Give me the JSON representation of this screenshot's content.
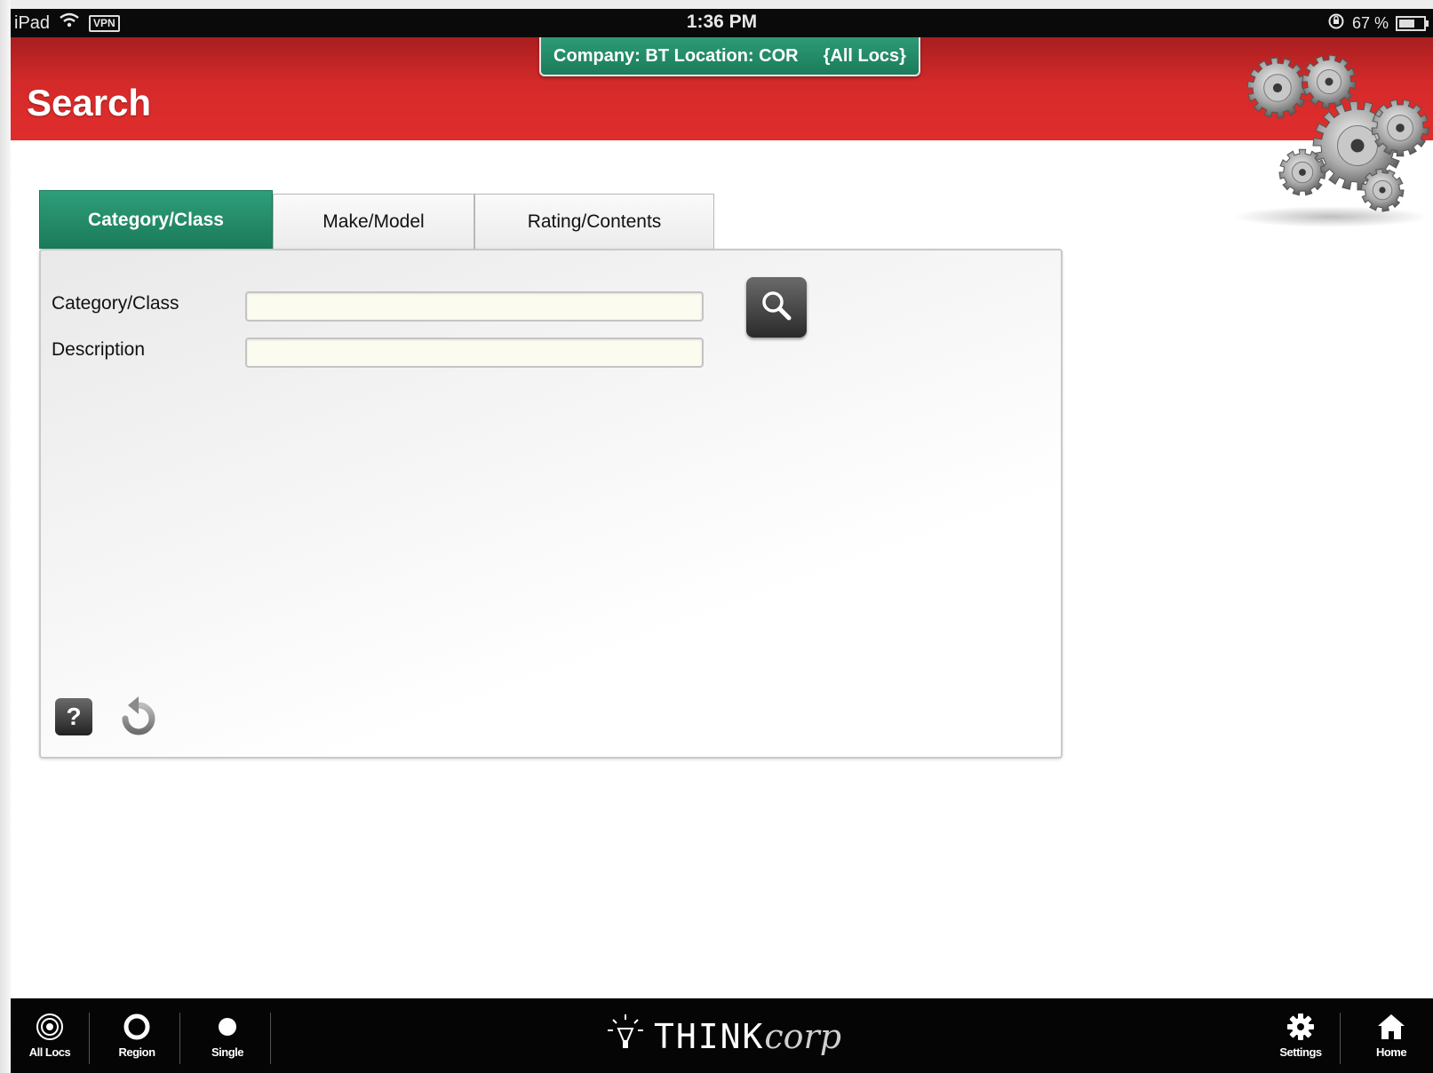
{
  "status_bar": {
    "device": "iPad",
    "vpn": "VPN",
    "time": "1:36 PM",
    "battery": "67 %",
    "battery_level": 0.67
  },
  "header": {
    "title": "Search",
    "company_banner": {
      "company_location": "Company: BT Location: COR",
      "scope": "{All Locs}"
    },
    "icon": "gears-icon"
  },
  "tabs": [
    {
      "label": "Category/Class",
      "active": true
    },
    {
      "label": "Make/Model",
      "active": false
    },
    {
      "label": "Rating/Contents",
      "active": false
    }
  ],
  "form": {
    "fields": [
      {
        "label": "Category/Class",
        "value": "",
        "placeholder": ""
      },
      {
        "label": "Description",
        "value": "",
        "placeholder": ""
      }
    ],
    "search_icon": "search-icon",
    "help_label": "?",
    "reset_icon": "reset-icon"
  },
  "bottom_bar": {
    "left_items": [
      {
        "label": "All Locs",
        "icon": "all-locs-icon"
      },
      {
        "label": "Region",
        "icon": "region-icon"
      },
      {
        "label": "Single",
        "icon": "single-icon"
      }
    ],
    "brand": {
      "think": "THINK",
      "corp": "corp",
      "icon": "lightbulb-icon"
    },
    "right_items": [
      {
        "label": "Settings",
        "icon": "gear-icon"
      },
      {
        "label": "Home",
        "icon": "home-icon"
      }
    ]
  },
  "colors": {
    "header_red": "#d52a2a",
    "accent_green": "#1f8a66",
    "bar_black": "#050505"
  }
}
